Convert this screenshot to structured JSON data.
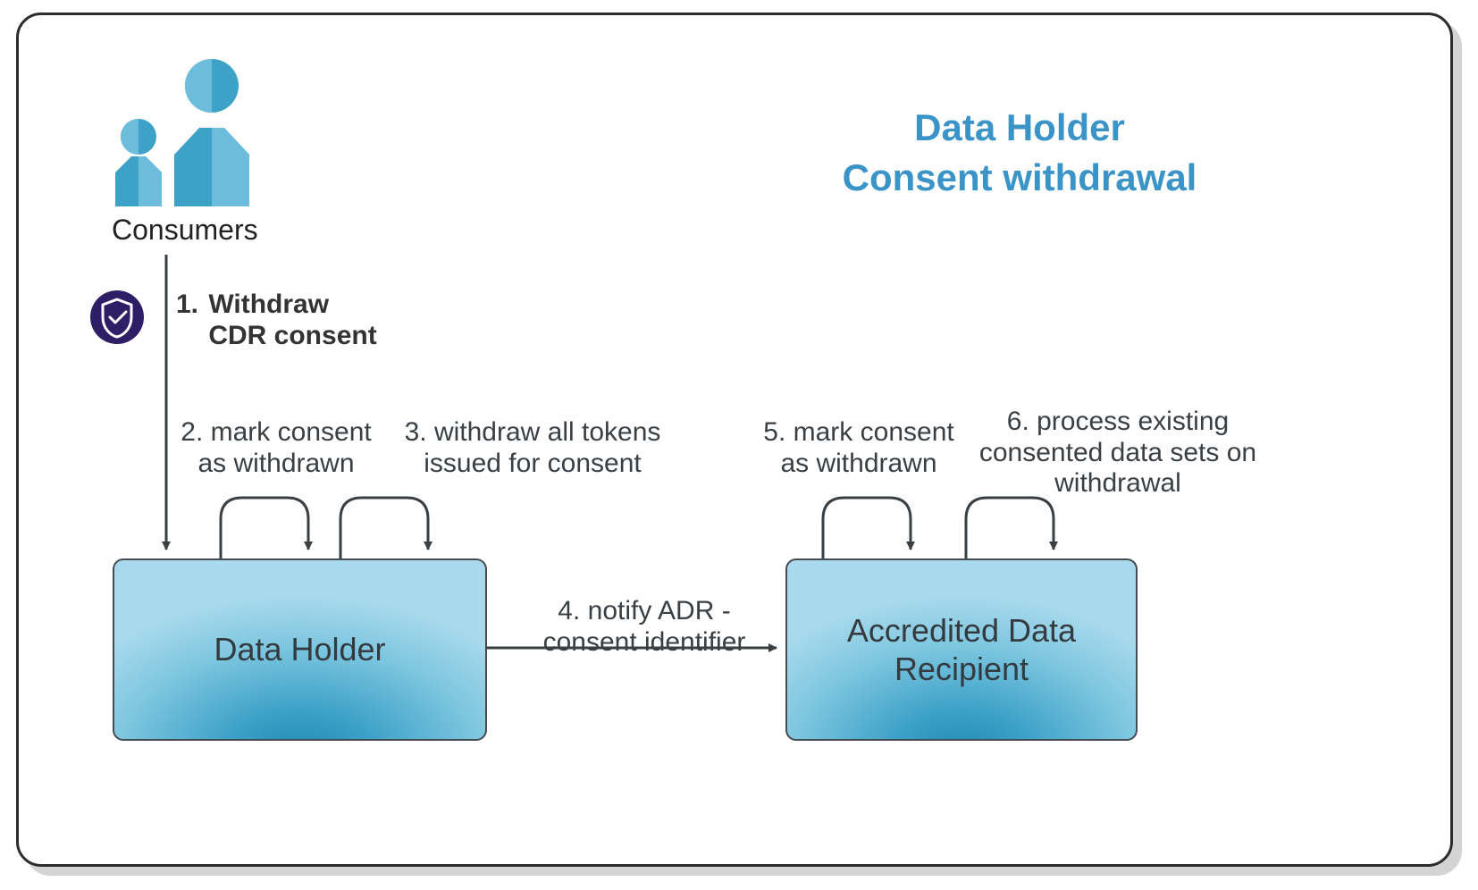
{
  "title_line1": "Data Holder",
  "title_line2": "Consent withdrawal",
  "consumers_label": "Consumers",
  "nodes": {
    "data_holder": "Data Holder",
    "adr": "Accredited Data\nRecipient"
  },
  "steps": {
    "s1_num": "1.",
    "s1_line1": "Withdraw",
    "s1_line2": "CDR consent",
    "s2_line1": "2. mark consent",
    "s2_line2": "as withdrawn",
    "s3_line1": "3. withdraw all tokens",
    "s3_line2": "issued for consent",
    "s4_line1": "4. notify ADR -",
    "s4_line2": "consent identifier",
    "s5_line1": "5. mark consent",
    "s5_line2": "as withdrawn",
    "s6_line1": "6. process existing",
    "s6_line2": "consented data sets on",
    "s6_line3": "withdrawal"
  }
}
